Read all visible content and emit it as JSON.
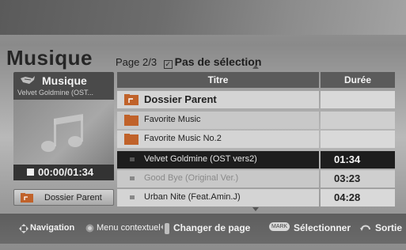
{
  "header": {
    "title": "Musique",
    "page_info": "Page 2/3",
    "selection_status": "Pas de sélection"
  },
  "now_playing": {
    "label": "Musique",
    "track": "Velvet Goldmine (OST...",
    "time": "00:00/01:34"
  },
  "parent_button": {
    "label": "Dossier Parent"
  },
  "table": {
    "columns": [
      "Titre",
      "Durée"
    ],
    "rows": [
      {
        "type": "parent-folder",
        "title": "Dossier Parent",
        "duration": ""
      },
      {
        "type": "folder",
        "title": "Favorite Music",
        "duration": ""
      },
      {
        "type": "folder",
        "title": "Favorite Music No.2",
        "duration": ""
      },
      {
        "type": "track",
        "title": "Velvet Goldmine (OST vers2)",
        "duration": "01:34",
        "highlighted": true
      },
      {
        "type": "track",
        "title": "Good Bye (Original Ver.)",
        "duration": "03:23"
      },
      {
        "type": "track",
        "title": "Urban Nite (Feat.Amin.J)",
        "duration": "04:28"
      }
    ]
  },
  "footer": {
    "navigation": "Navigation",
    "context_menu": "Menu contextuel",
    "change_page": "Changer de page",
    "mark_key": "MARK",
    "select": "Sélectionner",
    "exit": "Sortie"
  },
  "colors": {
    "highlight_row": "#1d1d1d",
    "header_bar": "#5b5b5b",
    "folder_orange": "#c0622a"
  }
}
